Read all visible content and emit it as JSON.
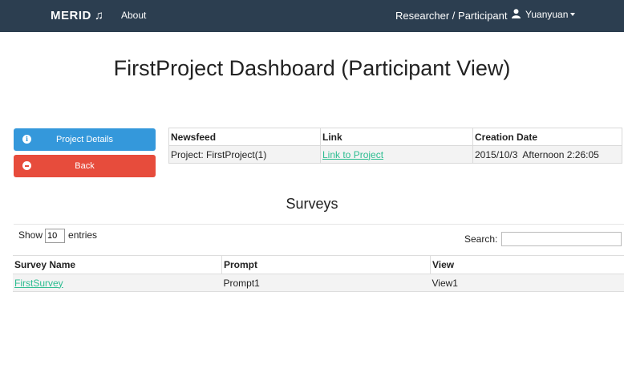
{
  "nav": {
    "brand": "MERID",
    "brand_icon": "music-note-icon",
    "about": "About",
    "role": "Researcher  / Participant",
    "user": "Yuanyuan"
  },
  "page": {
    "title": "FirstProject Dashboard (Participant View)"
  },
  "buttons": {
    "project_details": "Project Details",
    "back": "Back"
  },
  "newsfeed": {
    "headers": [
      "Newsfeed",
      "Link",
      "Creation Date"
    ],
    "rows": [
      {
        "newsfeed": "Project: FirstProject(1)",
        "link": "Link to Project",
        "date": "2015/10/3  Afternoon 2:26:05"
      }
    ]
  },
  "surveys": {
    "title": "Surveys",
    "show_label": "Show",
    "entries_label": "entries",
    "entries_value": "10",
    "search_label": "Search:",
    "search_value": "",
    "headers": [
      "Survey Name",
      "Prompt",
      "View"
    ],
    "rows": [
      {
        "name": "FirstSurvey",
        "prompt": "Prompt1",
        "view": "View1"
      }
    ]
  },
  "colors": {
    "navbar": "#2c3e50",
    "info": "#3498db",
    "danger": "#e74c3c",
    "link": "#2dbd91"
  }
}
